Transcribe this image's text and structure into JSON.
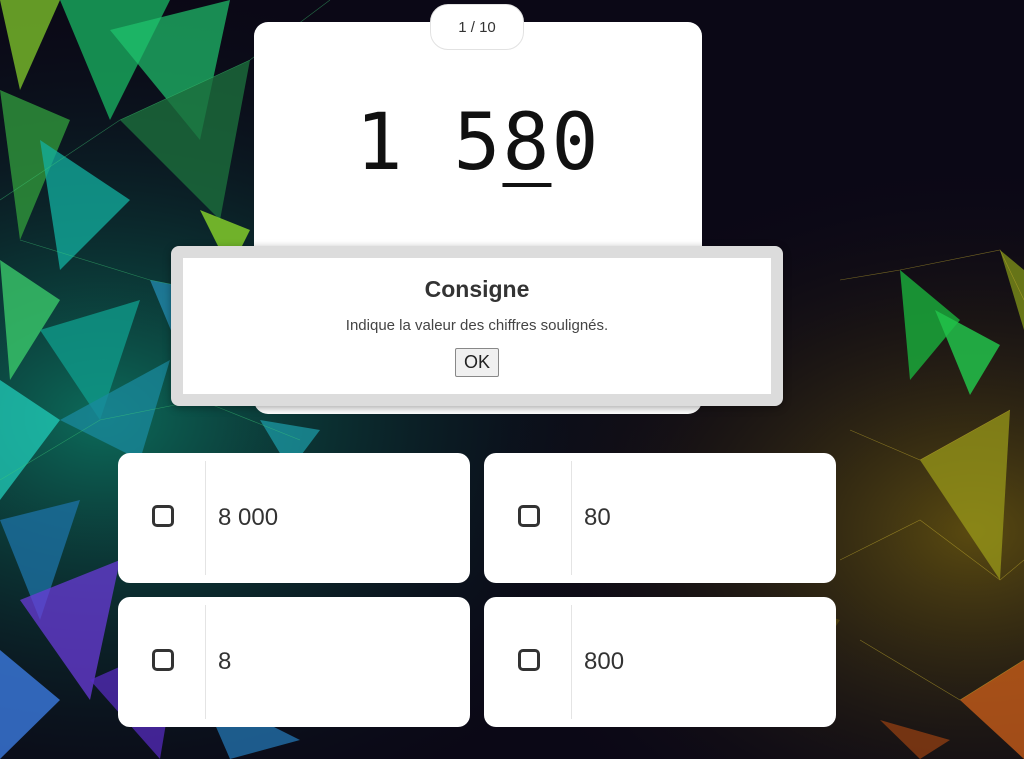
{
  "progress": {
    "counter": "1 / 10"
  },
  "question": {
    "number_prefix": "1 5",
    "number_underlined": "8",
    "number_suffix": "0"
  },
  "dialog": {
    "title": "Consigne",
    "text": "Indique la valeur des chiffres soulignés.",
    "ok_label": "OK"
  },
  "answers": [
    {
      "label": "8 000"
    },
    {
      "label": "80"
    },
    {
      "label": "8"
    },
    {
      "label": "800"
    }
  ],
  "icons": {
    "answer_checkbox": "checkbox-icon"
  },
  "colors": {
    "card": "#ffffff",
    "text": "#333333",
    "background": "#0a0714"
  }
}
